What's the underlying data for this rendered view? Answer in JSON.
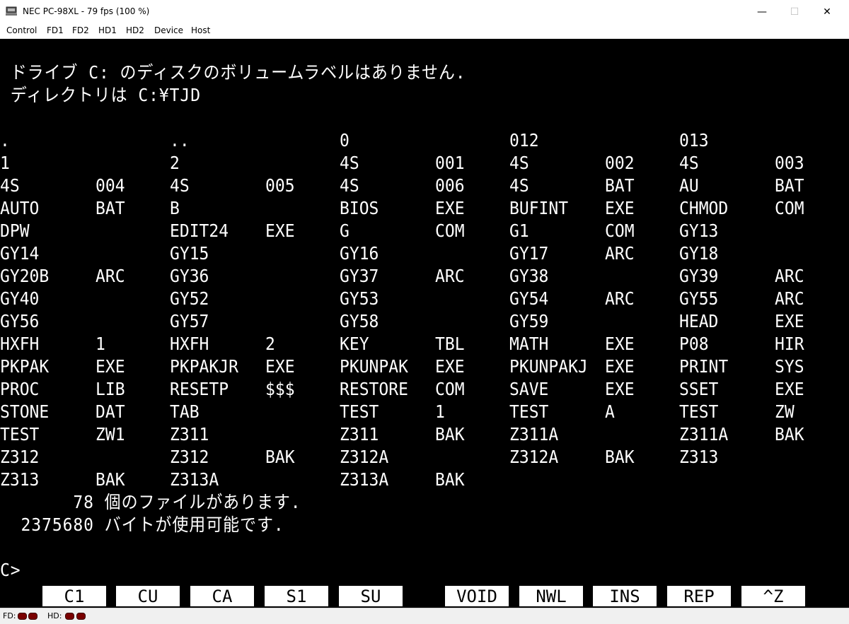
{
  "window": {
    "title": "NEC PC-98XL - 79 fps (100 %)",
    "controls": {
      "minimize": "—",
      "maximize": "☐",
      "close": "✕"
    }
  },
  "menu": [
    "Control",
    "FD1",
    "FD2",
    "HD1",
    "HD2",
    "Device",
    "Host"
  ],
  "console": {
    "header_line1": " ドライブ C: のディスクのボリュームラベルはありません.",
    "header_line2": " ディレクトリは C:¥TJD",
    "rows": [
      [
        [
          ".",
          ""
        ],
        [
          "..",
          ""
        ],
        [
          "0",
          ""
        ],
        [
          "012",
          ""
        ],
        [
          "013",
          ""
        ]
      ],
      [
        [
          "1",
          ""
        ],
        [
          "2",
          ""
        ],
        [
          "4S",
          "001"
        ],
        [
          "4S",
          "002"
        ],
        [
          "4S",
          "003"
        ]
      ],
      [
        [
          "4S",
          "004"
        ],
        [
          "4S",
          "005"
        ],
        [
          "4S",
          "006"
        ],
        [
          "4S",
          "BAT"
        ],
        [
          "AU",
          "BAT"
        ]
      ],
      [
        [
          "AUTO",
          "BAT"
        ],
        [
          "B",
          ""
        ],
        [
          "BIOS",
          "EXE"
        ],
        [
          "BUFINT",
          "EXE"
        ],
        [
          "CHMOD",
          "COM"
        ]
      ],
      [
        [
          "DPW",
          ""
        ],
        [
          "EDIT24",
          "EXE"
        ],
        [
          "G",
          "COM"
        ],
        [
          "G1",
          "COM"
        ],
        [
          "GY13",
          ""
        ]
      ],
      [
        [
          "GY14",
          ""
        ],
        [
          "GY15",
          ""
        ],
        [
          "GY16",
          ""
        ],
        [
          "GY17",
          "ARC"
        ],
        [
          "GY18",
          ""
        ]
      ],
      [
        [
          "GY20B",
          "ARC"
        ],
        [
          "GY36",
          ""
        ],
        [
          "GY37",
          "ARC"
        ],
        [
          "GY38",
          ""
        ],
        [
          "GY39",
          "ARC"
        ]
      ],
      [
        [
          "GY40",
          ""
        ],
        [
          "GY52",
          ""
        ],
        [
          "GY53",
          ""
        ],
        [
          "GY54",
          "ARC"
        ],
        [
          "GY55",
          "ARC"
        ]
      ],
      [
        [
          "GY56",
          ""
        ],
        [
          "GY57",
          ""
        ],
        [
          "GY58",
          ""
        ],
        [
          "GY59",
          ""
        ],
        [
          "HEAD",
          "EXE"
        ]
      ],
      [
        [
          "HXFH",
          "1"
        ],
        [
          "HXFH",
          "2"
        ],
        [
          "KEY",
          "TBL"
        ],
        [
          "MATH",
          "EXE"
        ],
        [
          "P08",
          "HIR"
        ]
      ],
      [
        [
          "PKPAK",
          "EXE"
        ],
        [
          "PKPAKJR",
          "EXE"
        ],
        [
          "PKUNPAK",
          "EXE"
        ],
        [
          "PKUNPAKJ",
          "EXE"
        ],
        [
          "PRINT",
          "SYS"
        ]
      ],
      [
        [
          "PROC",
          "LIB"
        ],
        [
          "RESETP",
          "$$$"
        ],
        [
          "RESTORE",
          "COM"
        ],
        [
          "SAVE",
          "EXE"
        ],
        [
          "SSET",
          "EXE"
        ]
      ],
      [
        [
          "STONE",
          "DAT"
        ],
        [
          "TAB",
          ""
        ],
        [
          "TEST",
          "1"
        ],
        [
          "TEST",
          "A"
        ],
        [
          "TEST",
          "ZW"
        ]
      ],
      [
        [
          "TEST",
          "ZW1"
        ],
        [
          "Z311",
          ""
        ],
        [
          "Z311",
          "BAK"
        ],
        [
          "Z311A",
          ""
        ],
        [
          "Z311A",
          "BAK"
        ]
      ],
      [
        [
          "Z312",
          ""
        ],
        [
          "Z312",
          "BAK"
        ],
        [
          "Z312A",
          ""
        ],
        [
          "Z312A",
          "BAK"
        ],
        [
          "Z313",
          ""
        ]
      ],
      [
        [
          "Z313",
          "BAK"
        ],
        [
          "Z313A",
          ""
        ],
        [
          "Z313A",
          "BAK"
        ]
      ]
    ],
    "file_count_line": "       78 個のファイルがあります.",
    "bytes_free_line": "  2375680 バイトが使用可能です.",
    "prompt": "C>"
  },
  "function_keys": [
    "C1",
    "CU",
    "CA",
    "S1",
    "SU",
    "VOID",
    "NWL",
    "INS",
    "REP",
    "^Z"
  ],
  "statusbar": {
    "fd_label": "FD:",
    "hd_label": "HD:",
    "led_color": "#7a0000"
  }
}
